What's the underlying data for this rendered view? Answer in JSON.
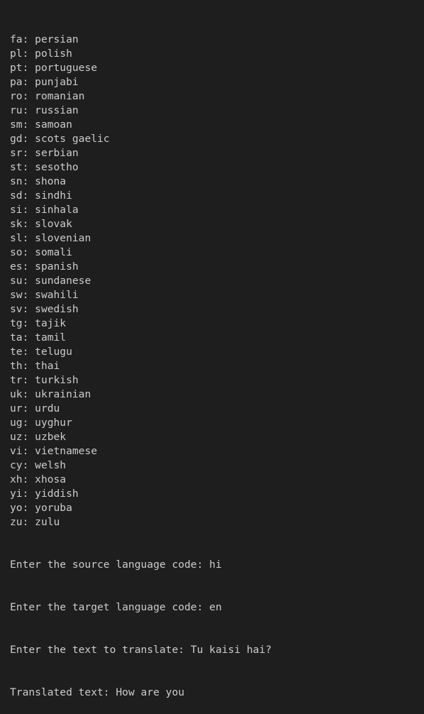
{
  "languages": [
    {
      "code": "fa",
      "name": "persian"
    },
    {
      "code": "pl",
      "name": "polish"
    },
    {
      "code": "pt",
      "name": "portuguese"
    },
    {
      "code": "pa",
      "name": "punjabi"
    },
    {
      "code": "ro",
      "name": "romanian"
    },
    {
      "code": "ru",
      "name": "russian"
    },
    {
      "code": "sm",
      "name": "samoan"
    },
    {
      "code": "gd",
      "name": "scots gaelic"
    },
    {
      "code": "sr",
      "name": "serbian"
    },
    {
      "code": "st",
      "name": "sesotho"
    },
    {
      "code": "sn",
      "name": "shona"
    },
    {
      "code": "sd",
      "name": "sindhi"
    },
    {
      "code": "si",
      "name": "sinhala"
    },
    {
      "code": "sk",
      "name": "slovak"
    },
    {
      "code": "sl",
      "name": "slovenian"
    },
    {
      "code": "so",
      "name": "somali"
    },
    {
      "code": "es",
      "name": "spanish"
    },
    {
      "code": "su",
      "name": "sundanese"
    },
    {
      "code": "sw",
      "name": "swahili"
    },
    {
      "code": "sv",
      "name": "swedish"
    },
    {
      "code": "tg",
      "name": "tajik"
    },
    {
      "code": "ta",
      "name": "tamil"
    },
    {
      "code": "te",
      "name": "telugu"
    },
    {
      "code": "th",
      "name": "thai"
    },
    {
      "code": "tr",
      "name": "turkish"
    },
    {
      "code": "uk",
      "name": "ukrainian"
    },
    {
      "code": "ur",
      "name": "urdu"
    },
    {
      "code": "ug",
      "name": "uyghur"
    },
    {
      "code": "uz",
      "name": "uzbek"
    },
    {
      "code": "vi",
      "name": "vietnamese"
    },
    {
      "code": "cy",
      "name": "welsh"
    },
    {
      "code": "xh",
      "name": "xhosa"
    },
    {
      "code": "yi",
      "name": "yiddish"
    },
    {
      "code": "yo",
      "name": "yoruba"
    },
    {
      "code": "zu",
      "name": "zulu"
    }
  ],
  "prompts": {
    "source_prompt": "Enter the source language code: ",
    "source_value": "hi",
    "target_prompt": "Enter the target language code: ",
    "target_value": "en",
    "text_prompt": "Enter the text to translate: ",
    "text_value": "Tu kaisi hai?",
    "result_prompt": "Translated text: ",
    "result_value": "How are you"
  },
  "colors": {
    "background": "#1e1e1e",
    "text": "#cccccc"
  }
}
